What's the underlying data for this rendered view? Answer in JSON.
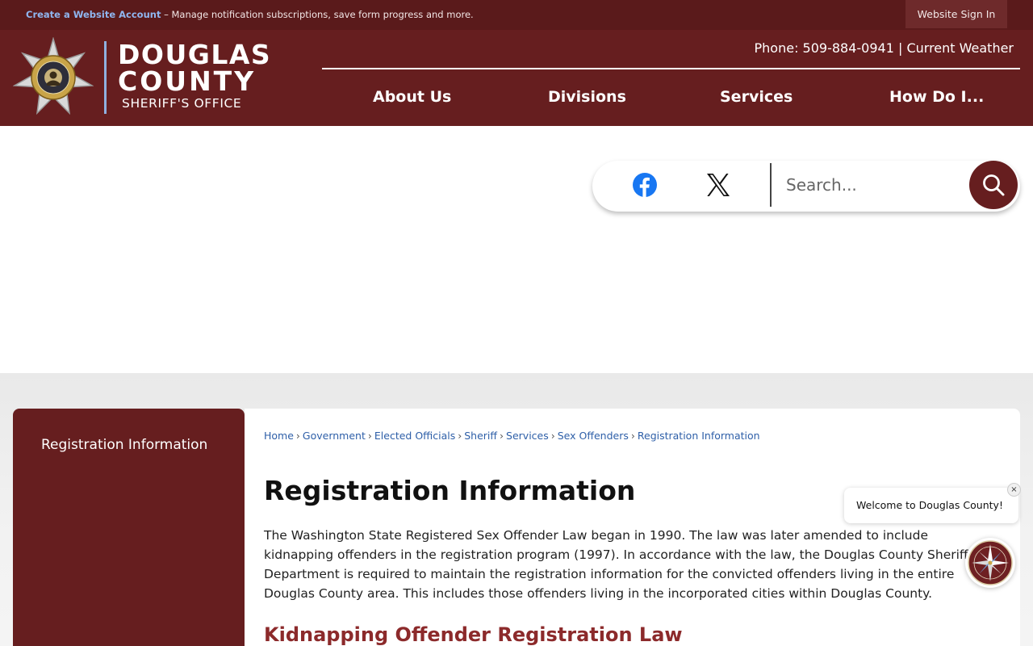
{
  "topbar": {
    "create_account": "Create a Website Account",
    "message": " – Manage notification subscriptions, save form progress and more.",
    "signin": "Website Sign In"
  },
  "logo": {
    "line1": "DOUGLAS",
    "line2": "COUNTY",
    "line3": "SHERIFF'S OFFICE",
    "badge_text_top": "DOUGLAS COUNTY",
    "badge_text_bottom": "SHERIFF'S OFFICE"
  },
  "contact": {
    "phone": "Phone: 509-884-0941",
    "separator": " | ",
    "weather": "Current Weather"
  },
  "nav": {
    "items": [
      "About Us",
      "Divisions",
      "Services",
      "How Do I..."
    ]
  },
  "search": {
    "placeholder": "Search..."
  },
  "sidebar": {
    "items": [
      "Registration Information"
    ]
  },
  "breadcrumb": {
    "items": [
      "Home",
      "Government",
      "Elected Officials",
      "Sheriff",
      "Services",
      "Sex Offenders",
      "Registration Information"
    ]
  },
  "main": {
    "title": "Registration Information",
    "body": "The Washington State Registered Sex Offender Law began in 1990. The law was later amended to include kidnapping offenders in the registration program (1997). In accordance with the law, the Douglas County Sheriff's Department is required to maintain the registration information for the convicted offenders living in the entire Douglas County area. This includes those offenders living in the incorporated cities within Douglas County.",
    "subheading": "Kidnapping Offender Registration Law"
  },
  "chat": {
    "welcome": "Welcome to Douglas County!",
    "close": "×"
  },
  "icons": {
    "badge": "sheriff-star-icon",
    "facebook": "facebook-icon",
    "x": "x-icon",
    "search": "search-icon",
    "chat": "compass-icon"
  },
  "colors": {
    "brand": "#661e1f",
    "topbar": "#5a1a1b",
    "link": "#2e5fa8",
    "subheading": "#8c2a2b",
    "facebook": "#1877f2"
  }
}
